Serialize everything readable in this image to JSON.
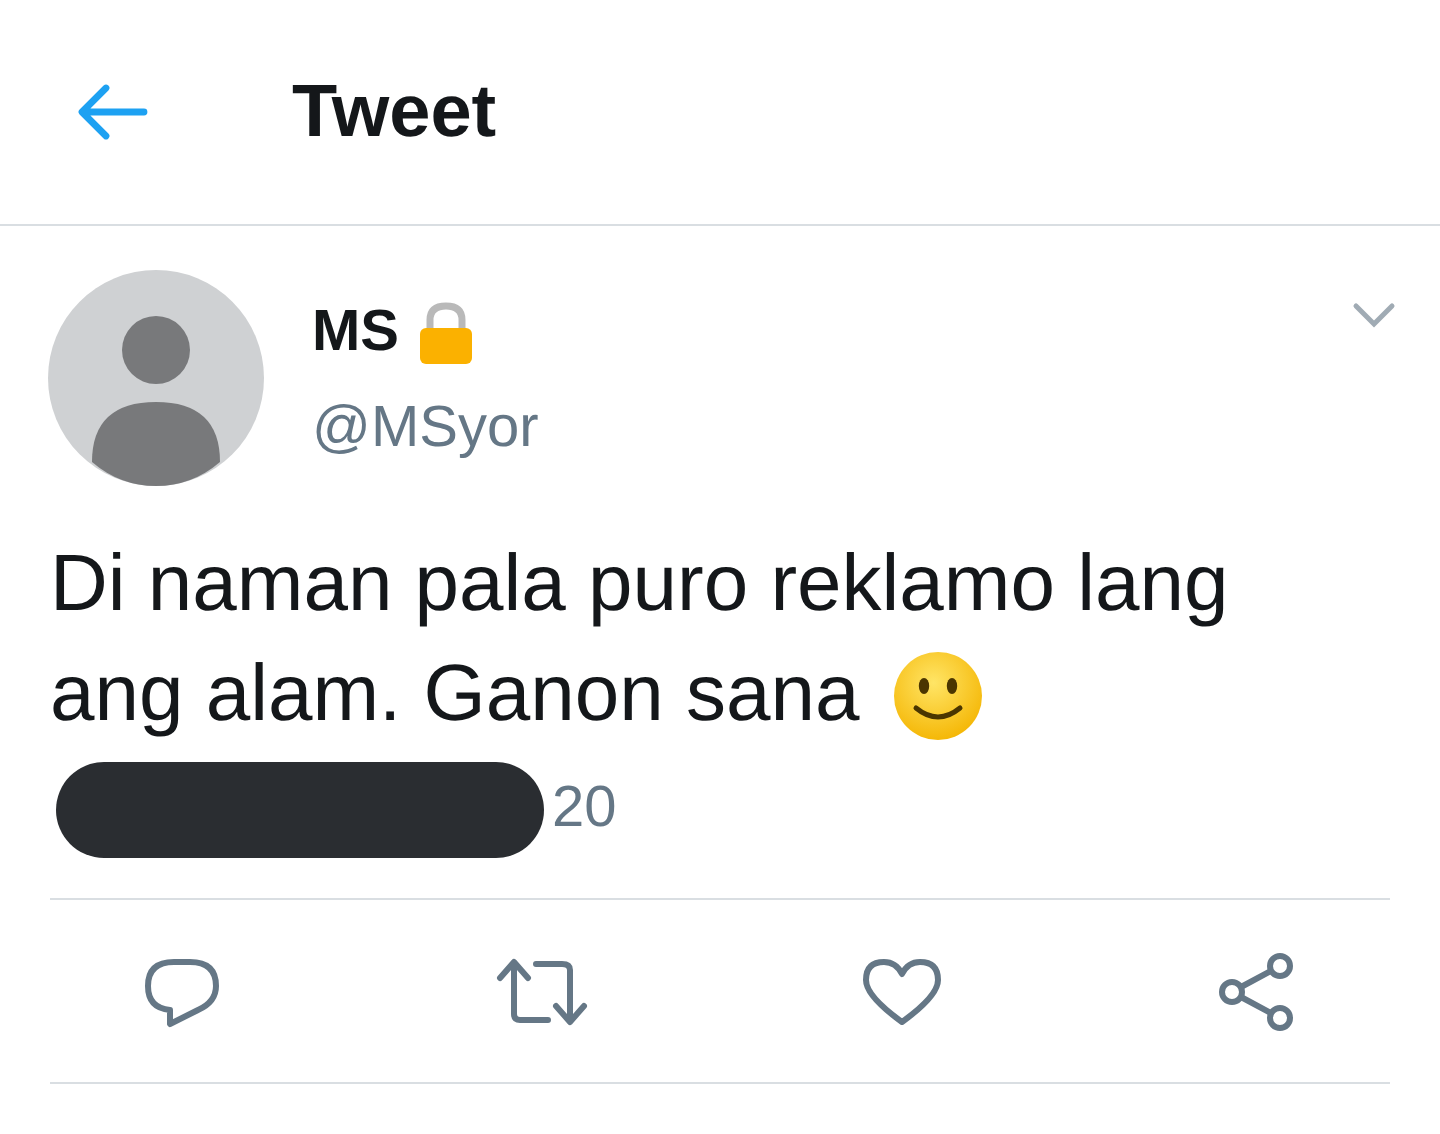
{
  "header": {
    "title": "Tweet"
  },
  "tweet": {
    "name": "MS",
    "protected": true,
    "handle": "@MSyor",
    "text_lines": [
      "Di naman pala puro reklamo lang",
      "ang alam. Ganon sana"
    ],
    "timestamp": {
      "redacted": true,
      "text": "20"
    }
  },
  "actions": [
    {
      "kind": "reply"
    },
    {
      "kind": "retweet"
    },
    {
      "kind": "like"
    },
    {
      "kind": "share"
    }
  ]
}
